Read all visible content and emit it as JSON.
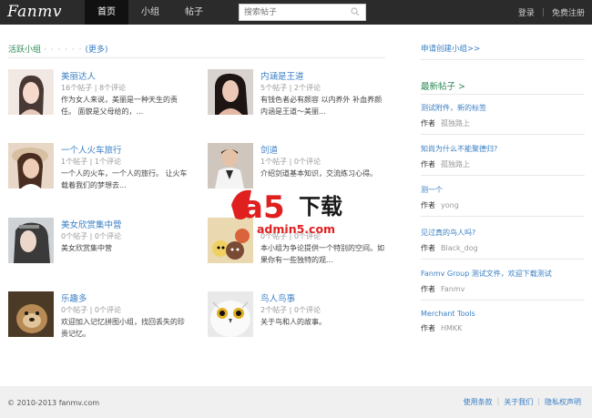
{
  "header": {
    "logo": "Fanmv",
    "nav": [
      "首页",
      "小组",
      "帖子"
    ],
    "search_placeholder": "搜索帖子",
    "login": "登录",
    "register": "免费注册"
  },
  "groups_section": {
    "title": "活跃小组",
    "dots": "· · · · · ·",
    "more": "(更多)"
  },
  "groups": [
    {
      "title": "美丽达人",
      "stats": "16个帖子 | 8个评论",
      "desc": "作为女人来说，美丽是一种天生的责任。 面貌是父母给的，..."
    },
    {
      "title": "内涵是王道",
      "stats": "5个帖子 | 2个评论",
      "desc": "有钱色者必有颜容 以内养外 补血养颜 内涵是王道～美丽..."
    },
    {
      "title": "一个人火车旅行",
      "stats": "1个帖子 | 1个评论",
      "desc": "一个人的火车，一个人的旅行。 让火车载着我们的梦想去..."
    },
    {
      "title": "剑道",
      "stats": "1个帖子 | 0个评论",
      "desc": "介绍剑道基本知识，交流练习心得。"
    },
    {
      "title": "美女欣赏集中营",
      "stats": "0个帖子 | 0个评论",
      "desc": "美女欣赏集中营"
    },
    {
      "title": "",
      "stats": "0个帖子 | 0个评论",
      "desc": "本小组为争论提供一个特别的空间。如果你有一些独特的观..."
    },
    {
      "title": "乐趣多",
      "stats": "0个帖子 | 0个评论",
      "desc": "欢迎加入记忆拼图小组，找回丢失的珍贵记忆。"
    },
    {
      "title": "鸟人鸟事",
      "stats": "2个帖子 | 0个评论",
      "desc": "关于鸟和人的故事。"
    }
  ],
  "sidebar": {
    "apply_link": "申请创建小组>>",
    "new_posts_title": "最新帖子 >",
    "author_label": "作者",
    "posts": [
      {
        "title": "测试附件，新的标签",
        "author": "孤独路上"
      },
      {
        "title": "知尚为什么不能聚德归?",
        "author": "孤独路上"
      },
      {
        "title": "测一个",
        "author": "yong"
      },
      {
        "title": "见过真的鸟人吗?",
        "author": "Black_dog"
      },
      {
        "title": "Fanmv Group 测试文件，欢迎下载测试",
        "author": "Fanmv"
      },
      {
        "title": "Merchant Tools",
        "author": "HMKK"
      }
    ]
  },
  "footer": {
    "copyright": "© 2010-2013 fanmv.com",
    "links": [
      "使用条款",
      "关于我们",
      "隐私权声明"
    ]
  },
  "watermark": {
    "brand": "a5",
    "cn": "下载",
    "url": "admin5.com"
  },
  "colors": {
    "topbar": "#2b2b2b",
    "accent_green": "#2e8b57",
    "link_blue": "#3a7fc4",
    "watermark_red": "#e01f1f"
  }
}
